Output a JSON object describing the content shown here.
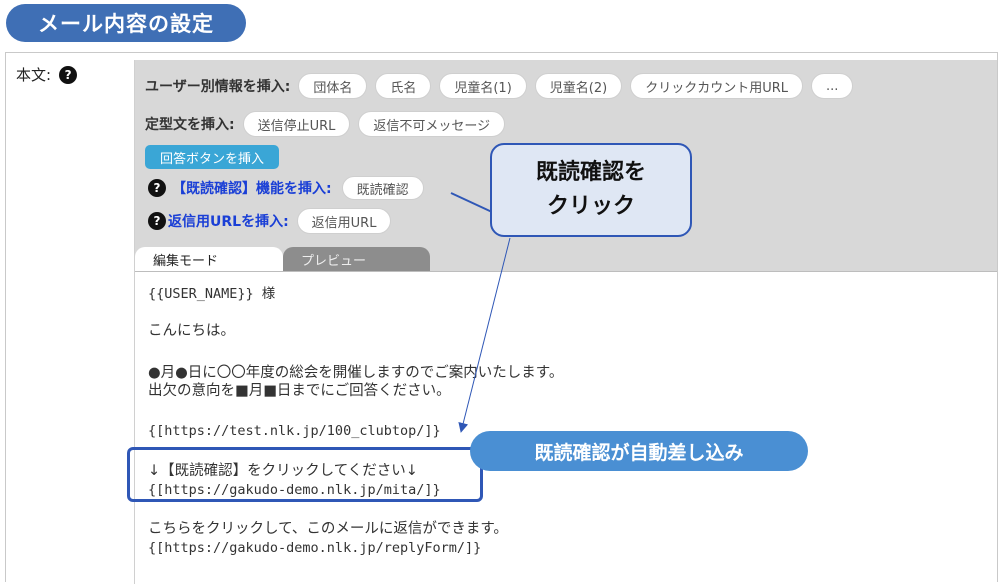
{
  "header": {
    "title": "メール内容の設定"
  },
  "field": {
    "label": "本文:",
    "help_icon": "?"
  },
  "toolbar": {
    "user_info_label": "ユーザー別情報を挿入:",
    "user_info_chips": [
      "団体名",
      "氏名",
      "児童名(1)",
      "児童名(2)",
      "クリックカウント用URL",
      "..."
    ],
    "template_label": "定型文を挿入:",
    "template_chips": [
      "送信停止URL",
      "返信不可メッセージ"
    ],
    "answer_button": "回答ボタンを挿入",
    "read_confirm_label": "【既読確認】機能を挿入:",
    "read_confirm_chip": "既読確認",
    "reply_url_label": "返信用URLを挿入:",
    "reply_url_chip": "返信用URL"
  },
  "tabs": {
    "edit": "編集モード",
    "preview": "プレビュー"
  },
  "editor": {
    "lines": {
      "greeting_name": "{{USER_NAME}} 様",
      "hello": "こんにちは。",
      "line1": "●月●日に〇〇年度の総会を開催しますのでご案内いたします。",
      "line2": "出欠の意向を■月■日までにご回答ください。",
      "url1": "{[https://test.nlk.jp/100_clubtop/]}",
      "read_confirm_text": "↓【既読確認】をクリックしてください↓",
      "read_confirm_url": "{[https://gakudo-demo.nlk.jp/mita/]}",
      "reply_text": "こちらをクリックして、このメールに返信ができます。",
      "reply_url": "{[https://gakudo-demo.nlk.jp/replyForm/]}"
    }
  },
  "annotations": {
    "callout_line1": "既読確認を",
    "callout_line2": "クリック",
    "auto_insert_badge": "既読確認が自動差し込み"
  },
  "colors": {
    "title_bg": "#3f6fb5",
    "answer_button_bg": "#3aa6d6",
    "callout_border": "#2f57b6",
    "badge_bg": "#4a8fd3",
    "label_blue": "#1a3fd6"
  }
}
